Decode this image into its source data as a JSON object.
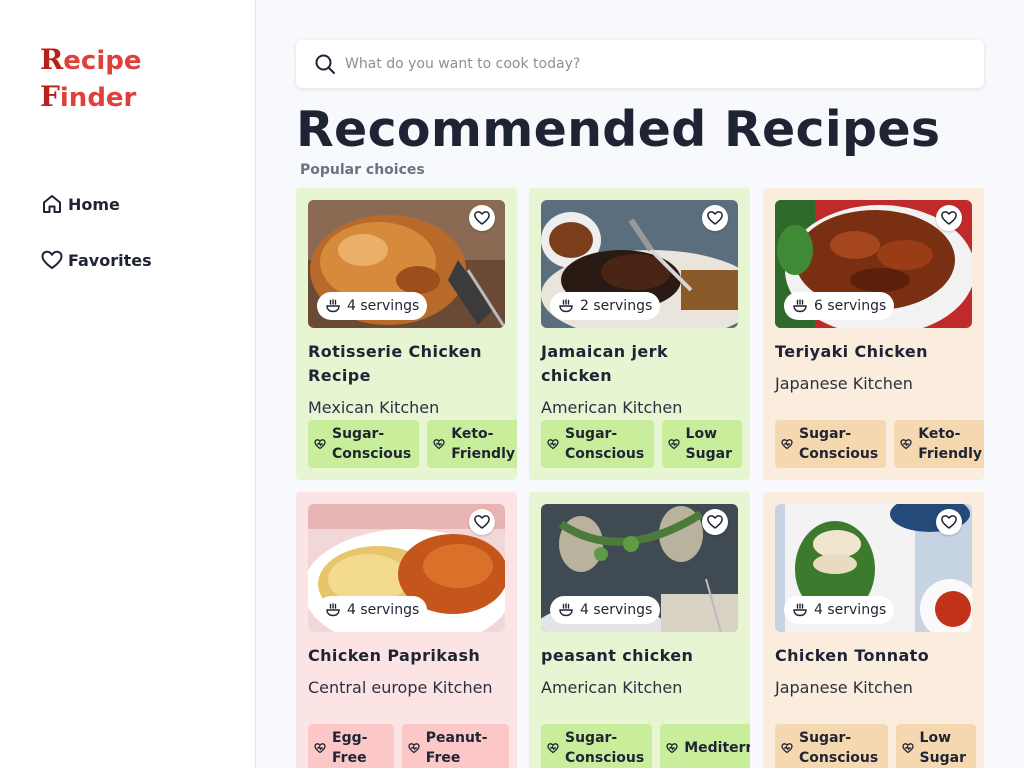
{
  "app": {
    "logo_line1_cap": "R",
    "logo_line1_rest": "ecipe",
    "logo_line2_cap": "F",
    "logo_line2_rest": "inder"
  },
  "sidebar": {
    "items": [
      {
        "label": "Home",
        "icon": "home-icon"
      },
      {
        "label": "Favorites",
        "icon": "heart-icon"
      }
    ]
  },
  "search": {
    "placeholder": "What do you want to cook today?",
    "value": ""
  },
  "main": {
    "title": "Recommended Recipes",
    "subtitle": "Popular choices"
  },
  "colors": {
    "accent": "#e0403c",
    "card_green": "#e7f5d3",
    "card_peach": "#fbedde",
    "card_pink": "#fde4e4"
  },
  "recipes": [
    {
      "name": "Rotisserie Chicken Recipe",
      "kitchen": "Mexican Kitchen",
      "servings": "4 servings",
      "theme": "green",
      "image": "roast-chicken",
      "tags": [
        "Sugar-Conscious",
        "Keto-Friendly"
      ]
    },
    {
      "name": "Jamaican jerk chicken",
      "kitchen": "American Kitchen",
      "servings": "2 servings",
      "theme": "green",
      "image": "jerk-chicken",
      "tags": [
        "Sugar-Conscious",
        "Low Sugar"
      ]
    },
    {
      "name": "Teriyaki Chicken",
      "kitchen": "Japanese Kitchen",
      "servings": "6 servings",
      "theme": "peach",
      "image": "teriyaki-chicken",
      "tags": [
        "Sugar-Conscious",
        "Keto-Friendly"
      ]
    },
    {
      "name": "Chicken Paprikash",
      "kitchen": "Central europe Kitchen",
      "servings": "4 servings",
      "theme": "pink",
      "image": "paprikash",
      "tags": [
        "Egg-Free",
        "Peanut-Free"
      ]
    },
    {
      "name": "peasant chicken",
      "kitchen": "American Kitchen",
      "servings": "4 servings",
      "theme": "green",
      "image": "peasant-chicken",
      "tags": [
        "Sugar-Conscious",
        "Mediterranean"
      ]
    },
    {
      "name": "Chicken Tonnato",
      "kitchen": "Japanese Kitchen",
      "servings": "4 servings",
      "theme": "peach",
      "image": "chicken-tonnato",
      "tags": [
        "Sugar-Conscious",
        "Low Sugar"
      ]
    }
  ]
}
